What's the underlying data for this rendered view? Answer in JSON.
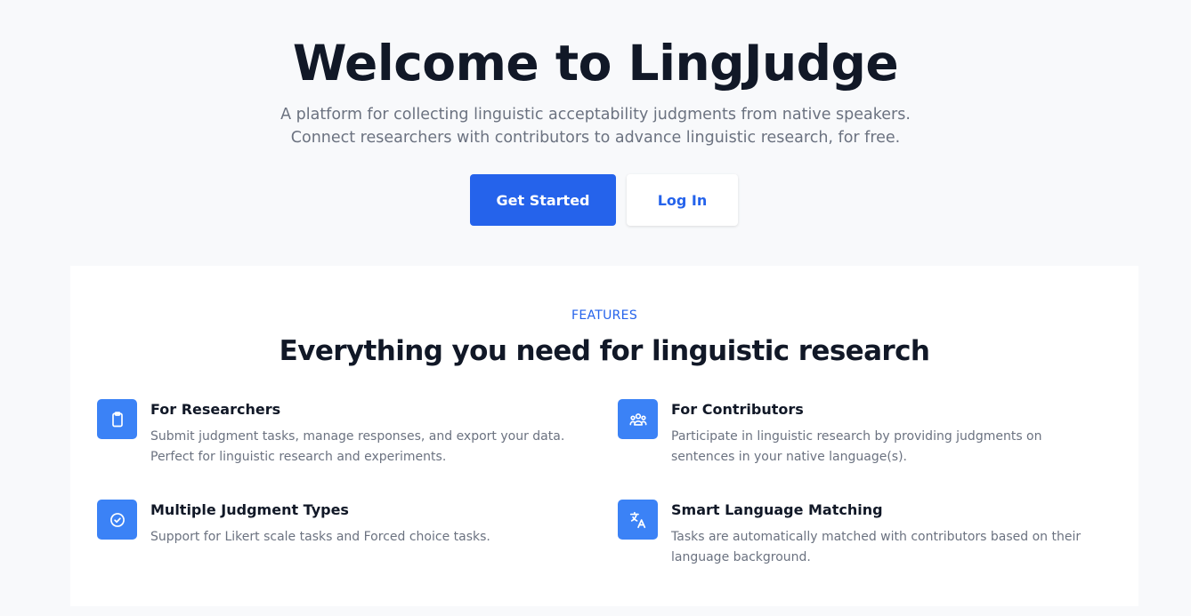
{
  "hero": {
    "title": "Welcome to LingJudge",
    "subtitle_line1": "A platform for collecting linguistic acceptability judgments from native speakers.",
    "subtitle_line2": "Connect researchers with contributors to advance linguistic research, for free.",
    "primary_button": "Get Started",
    "secondary_button": "Log In"
  },
  "features": {
    "eyebrow": "FEATURES",
    "title": "Everything you need for linguistic research",
    "items": [
      {
        "icon": "clipboard-icon",
        "title": "For Researchers",
        "description": "Submit judgment tasks, manage responses, and export your data. Perfect for linguistic research and experiments."
      },
      {
        "icon": "user-group-icon",
        "title": "For Contributors",
        "description": "Participate in linguistic research by providing judgments on sentences in your native language(s)."
      },
      {
        "icon": "check-circle-icon",
        "title": "Multiple Judgment Types",
        "description": "Support for Likert scale tasks and Forced choice tasks."
      },
      {
        "icon": "translate-icon",
        "title": "Smart Language Matching",
        "description": "Tasks are automatically matched with contributors based on their language background."
      }
    ]
  },
  "colors": {
    "accent": "#2563eb",
    "icon_bg": "#3b82f6",
    "heading": "#111827",
    "muted_text": "#6b7280",
    "page_bg": "#f8f9fb"
  }
}
